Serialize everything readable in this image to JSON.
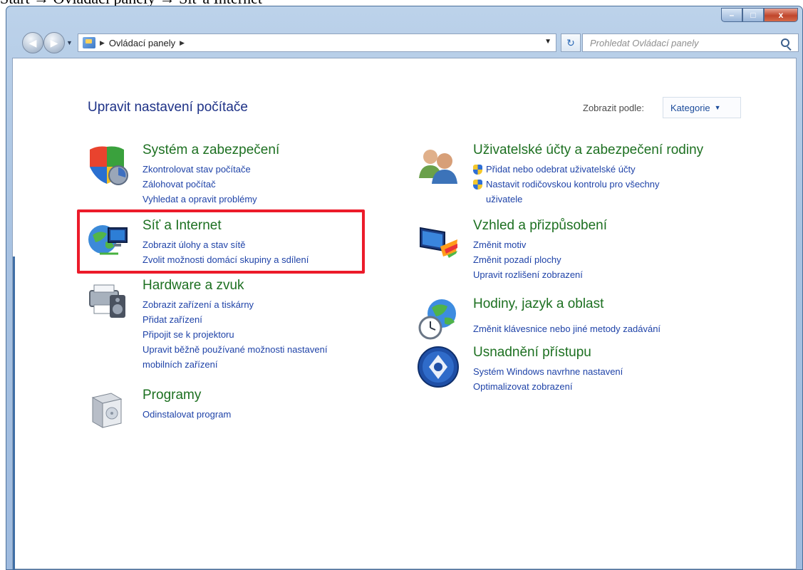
{
  "caption": "Start → Ovládací panely → Síť a Internet",
  "window": {
    "controls": {
      "minimize": "–",
      "maximize": "□",
      "close": "x"
    }
  },
  "nav": {
    "back": "◀",
    "forward": "▶",
    "dropdown": "▼",
    "breadcrumb": [
      "Ovládací panely"
    ],
    "separator": "▶",
    "address_dropdown": "▼",
    "refresh": "↻",
    "search_placeholder": "Prohledat Ovládací panely"
  },
  "header": {
    "title": "Upravit nastavení počítače",
    "view_by_label": "Zobrazit podle:",
    "view_by_value": "Kategorie",
    "view_by_arrow": "▼"
  },
  "categories_left": [
    {
      "title": "Systém a zabezpečení",
      "icon": "security-shield-icon",
      "links": [
        "Zkontrolovat stav počítače",
        "Zálohovat počítač",
        "Vyhledat a opravit problémy"
      ]
    },
    {
      "title": "Síť a Internet",
      "icon": "network-globe-icon",
      "links": [
        "Zobrazit úlohy a stav sítě",
        "Zvolit možnosti domácí skupiny a sdílení"
      ]
    },
    {
      "title": "Hardware a zvuk",
      "icon": "printer-speaker-icon",
      "links": [
        "Zobrazit zařízení a tiskárny",
        "Přidat zařízení",
        "Připojit se k projektoru",
        "Upravit běžně používané možnosti nastavení",
        "mobilních zařízení"
      ]
    },
    {
      "title": "Programy",
      "icon": "programs-box-icon",
      "links": [
        "Odinstalovat program"
      ]
    }
  ],
  "categories_right": [
    {
      "title": "Uživatelské účty a zabezpečení rodiny",
      "icon": "users-icon",
      "links": [
        "Přidat nebo odebrat uživatelské účty",
        "Nastavit rodičovskou kontrolu pro všechny",
        "uživatele"
      ]
    },
    {
      "title": "Vzhled a přizpůsobení",
      "icon": "appearance-monitor-icon",
      "links": [
        "Změnit motiv",
        "Změnit pozadí plochy",
        "Upravit rozlišení zobrazení"
      ]
    },
    {
      "title": "Hodiny, jazyk a oblast",
      "icon": "clock-globe-icon",
      "links": [
        "Změnit klávesnice nebo jiné metody zadávání"
      ]
    },
    {
      "title": "Usnadnění přístupu",
      "icon": "accessibility-icon",
      "links": [
        "Systém Windows navrhne nastavení",
        "Optimalizovat zobrazení"
      ]
    }
  ]
}
